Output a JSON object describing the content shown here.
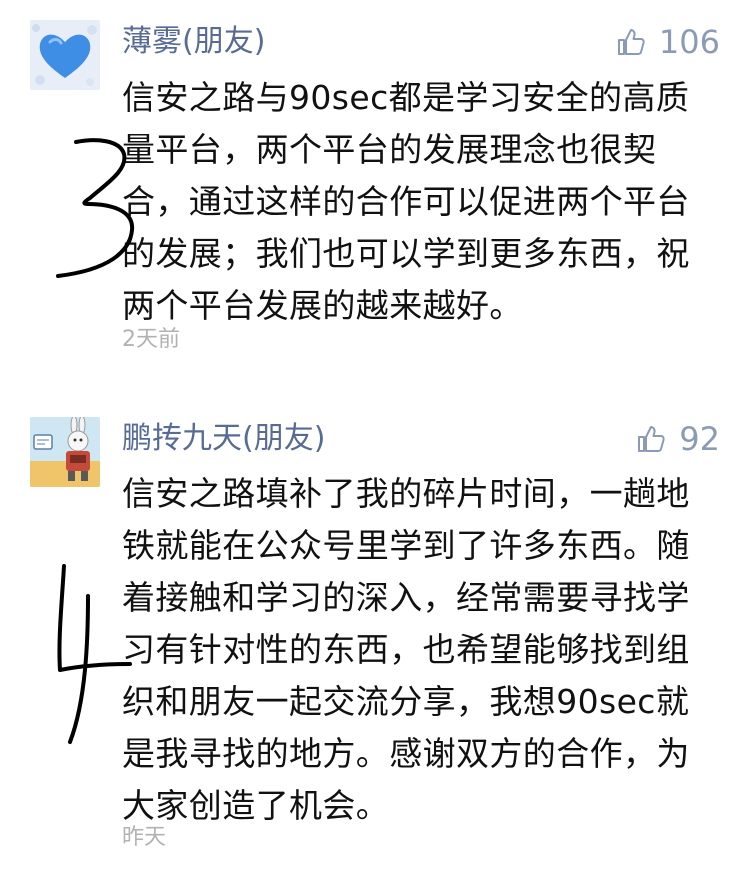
{
  "comments": [
    {
      "nickname": "薄雾(朋友)",
      "likes": "106",
      "lines": [
        "信安之路与90sec都是学习安全的高质",
        "量平台，两个平台的发展理念也很契",
        "合，通过这样的合作可以促进两个平台",
        "的发展；我们也可以学到更多东西，祝",
        "两个平台发展的越来越好。"
      ],
      "time": "2天前",
      "handwritten_mark": "3"
    },
    {
      "nickname": "鹏抟九天(朋友)",
      "likes": "92",
      "lines": [
        "信安之路填补了我的碎片时间，一趟地",
        "铁就能在公众号里学到了许多东西。随",
        "着接触和学习的深入，经常需要寻找学",
        "习有针对性的东西，也希望能够找到组",
        "织和朋友一起交流分享，我想90sec就",
        "是我寻找的地方。感谢双方的合作，为",
        "大家创造了机会。"
      ],
      "time": "昨天",
      "handwritten_mark": "4"
    }
  ],
  "colors": {
    "nickname": "#576b95",
    "body_text": "#111111",
    "meta_text": "#b2b2b2",
    "like": "#8c9bb5",
    "ink": "#000000"
  },
  "icons": {
    "like": "thumbs-up-icon",
    "avatar_1": "blue-heart-avatar",
    "avatar_2": "cartoon-rabbit-robot-avatar"
  }
}
